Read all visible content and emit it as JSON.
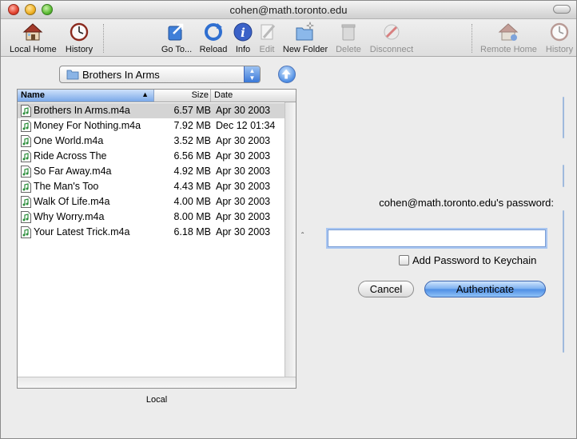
{
  "window": {
    "title": "cohen@math.toronto.edu"
  },
  "toolbar": {
    "local_home": "Local Home",
    "history_left": "History",
    "go_to": "Go To...",
    "reload": "Reload",
    "info": "Info",
    "edit": "Edit",
    "new_folder": "New Folder",
    "delete": "Delete",
    "disconnect": "Disconnect",
    "remote_home": "Remote Home",
    "history_right": "History"
  },
  "local": {
    "folder": "Brothers In Arms",
    "pane_label": "Local",
    "columns": {
      "name": "Name",
      "size": "Size",
      "date": "Date"
    },
    "files": [
      {
        "name": "Brothers In Arms.m4a",
        "size": "6.57 MB",
        "date": "Apr 30 2003"
      },
      {
        "name": "Money For Nothing.m4a",
        "size": "7.92 MB",
        "date": "Dec 12 01:34"
      },
      {
        "name": "One World.m4a",
        "size": "3.52 MB",
        "date": "Apr 30 2003"
      },
      {
        "name": "Ride Across The",
        "size": "6.56 MB",
        "date": "Apr 30 2003"
      },
      {
        "name": "So Far Away.m4a",
        "size": "4.92 MB",
        "date": "Apr 30 2003"
      },
      {
        "name": "The Man's Too",
        "size": "4.43 MB",
        "date": "Apr 30 2003"
      },
      {
        "name": "Walk Of Life.m4a",
        "size": "4.00 MB",
        "date": "Apr 30 2003"
      },
      {
        "name": "Why Worry.m4a",
        "size": "8.00 MB",
        "date": "Apr 30 2003"
      },
      {
        "name": "Your Latest Trick.m4a",
        "size": "6.18 MB",
        "date": "Apr 30 2003"
      }
    ]
  },
  "auth": {
    "prompt": "cohen@math.toronto.edu's password:",
    "password_value": "",
    "keychain_label": "Add Password to Keychain",
    "cancel": "Cancel",
    "authenticate": "Authenticate"
  },
  "icons": {
    "local_home": "house-icon",
    "history": "clock-icon",
    "go_to": "arrow-box-icon",
    "reload": "reload-icon",
    "info": "info-icon",
    "edit": "edit-icon",
    "new_folder": "new-folder-icon",
    "delete": "trash-icon",
    "disconnect": "disconnect-icon",
    "file": "music-file-icon"
  },
  "colors": {
    "selection_blue": "#4d8de4",
    "selected_row": "#d4d4d4",
    "focus_ring": "#a9c6f1"
  }
}
